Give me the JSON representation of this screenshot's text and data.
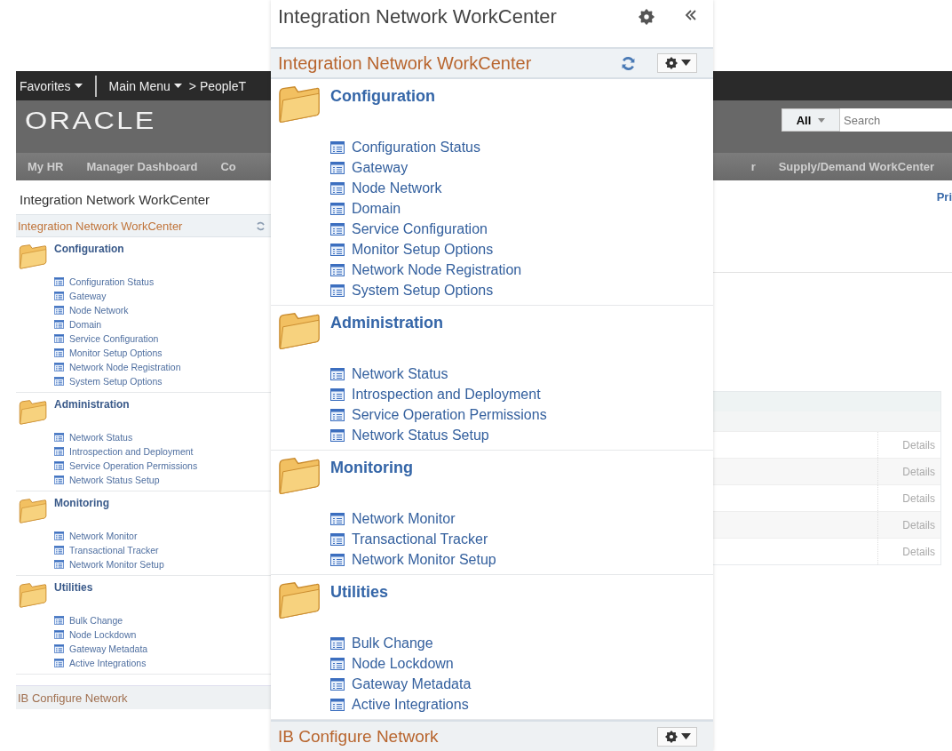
{
  "background": {
    "top_bar": {
      "favorites": "Favorites",
      "main_menu": "Main Menu",
      "breadcrumb": "> PeopleT"
    },
    "logo": "ORACLE",
    "search": {
      "scope": "All",
      "placeholder": "Search"
    },
    "nav_left": [
      "My HR",
      "Manager Dashboard",
      "Co"
    ],
    "nav_right": [
      "r",
      "Supply/Demand WorkCenter"
    ],
    "page_title": "Integration Network WorkCenter",
    "link": "Pri",
    "sidebar": {
      "pagelet_title": "Integration Network WorkCenter",
      "sections": [
        {
          "title": "Configuration",
          "items": [
            "Configuration Status",
            "Gateway",
            "Node Network",
            "Domain",
            "Service Configuration",
            "Monitor Setup Options",
            "Network Node Registration",
            "System Setup Options"
          ]
        },
        {
          "title": "Administration",
          "items": [
            "Network Status",
            "Introspection and Deployment",
            "Service Operation Permissions",
            "Network Status Setup"
          ]
        },
        {
          "title": "Monitoring",
          "items": [
            "Network Monitor",
            "Transactional Tracker",
            "Network Monitor Setup"
          ]
        },
        {
          "title": "Utilities",
          "items": [
            "Bulk Change",
            "Node Lockdown",
            "Gateway Metadata",
            "Active Integrations"
          ]
        }
      ],
      "footer": "IB Configure Network"
    },
    "table": {
      "rows": [
        {
          "column_2": "Details"
        },
        {
          "column_2": "Details"
        },
        {
          "column_2": "Details"
        },
        {
          "column_2": "Details"
        },
        {
          "column_2": "Details"
        }
      ]
    }
  },
  "callout": {
    "title": "Integration Network WorkCenter",
    "pagelet_title": "Integration Network WorkCenter",
    "sections": [
      {
        "title": "Configuration",
        "items": [
          "Configuration Status",
          "Gateway",
          "Node Network",
          "Domain",
          "Service Configuration",
          "Monitor Setup Options",
          "Network Node Registration",
          "System Setup Options"
        ]
      },
      {
        "title": "Administration",
        "items": [
          "Network Status",
          "Introspection and Deployment",
          "Service Operation Permissions",
          "Network Status Setup"
        ]
      },
      {
        "title": "Monitoring",
        "items": [
          "Network Monitor",
          "Transactional Tracker",
          "Network Monitor Setup"
        ]
      },
      {
        "title": "Utilities",
        "items": [
          "Bulk Change",
          "Node Lockdown",
          "Gateway Metadata",
          "Active Integrations"
        ]
      }
    ],
    "footer": "IB Configure Network"
  }
}
